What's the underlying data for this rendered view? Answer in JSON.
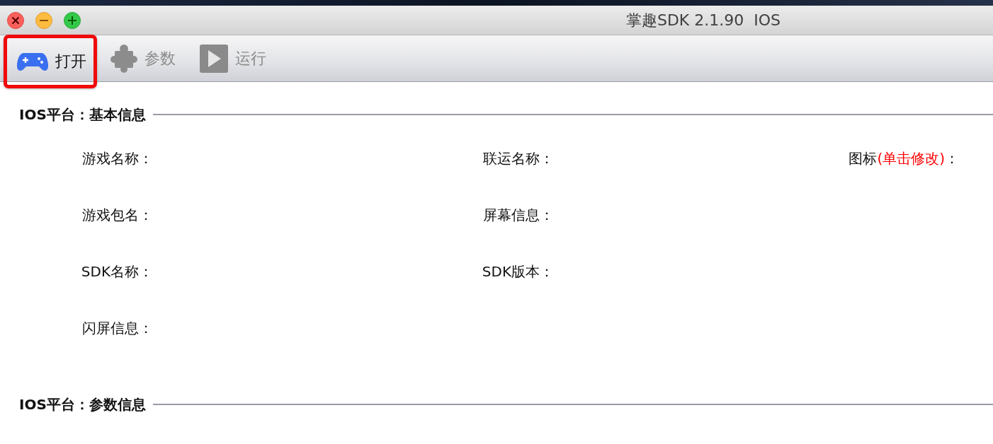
{
  "window": {
    "title": "掌趣SDK 2.1.90  IOS"
  },
  "toolbar": [
    {
      "label": "打开",
      "kind": "open",
      "disabled": false,
      "highlighted": true
    },
    {
      "label": "参数",
      "kind": "params",
      "disabled": true,
      "highlighted": false
    },
    {
      "label": "运行",
      "kind": "run",
      "disabled": true,
      "highlighted": false
    }
  ],
  "sections": [
    {
      "title": "IOS平台：基本信息",
      "rows": [
        {
          "fields": [
            {
              "label": "游戏名称："
            },
            {
              "label": "联运名称："
            },
            {
              "label": "图标",
              "hint": "(单击修改)",
              "suffix": "："
            }
          ]
        },
        {
          "fields": [
            {
              "label": "游戏包名："
            },
            {
              "label": "屏幕信息："
            }
          ]
        },
        {
          "fields": [
            {
              "label": "SDK名称："
            },
            {
              "label": "SDK版本："
            }
          ]
        },
        {
          "fields": [
            {
              "label": "闪屏信息："
            }
          ]
        }
      ]
    },
    {
      "title": "IOS平台：参数信息"
    }
  ]
}
